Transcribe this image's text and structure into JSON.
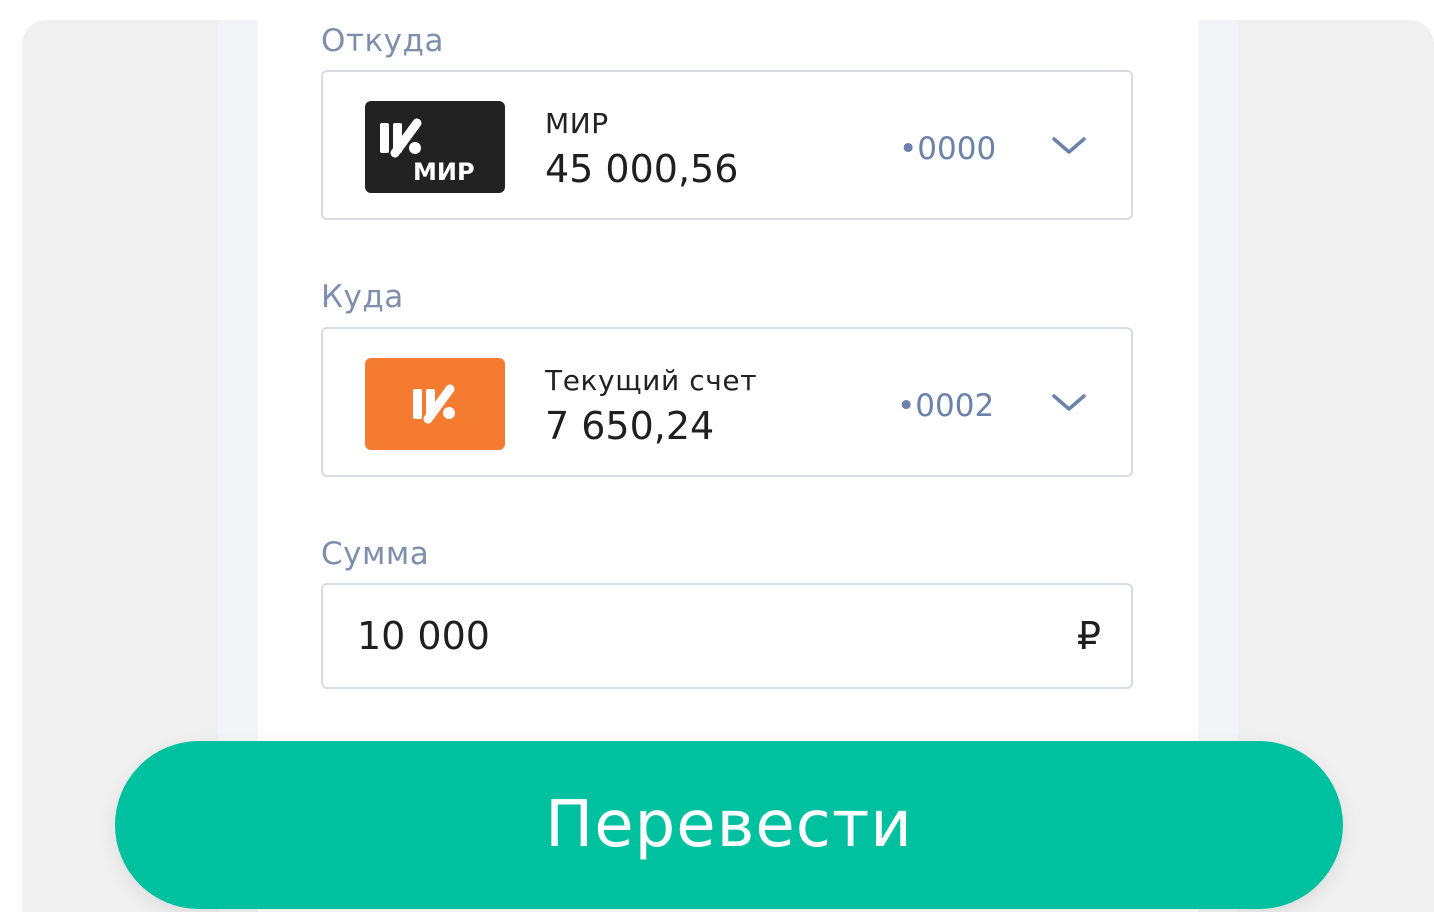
{
  "colors": {
    "label": "#7e8fae",
    "account_number": "#6b82ab",
    "border": "#d7dbe3",
    "mir_card": "#222222",
    "current_account_card": "#f47b30",
    "submit_button": "#00c19f"
  },
  "from": {
    "label": "Откуда",
    "card_icon": "mir-card-icon",
    "card_logo_text": "МИР",
    "name": "МИР",
    "balance": "45 000,56",
    "number": "•0000",
    "dropdown_icon": "chevron-down-icon"
  },
  "to": {
    "label": "Куда",
    "card_icon": "bank-logo-icon",
    "name": "Текущий счет",
    "balance": "7 650,24",
    "number": "•0002",
    "dropdown_icon": "chevron-down-icon"
  },
  "amount": {
    "label": "Сумма",
    "value": "10 000",
    "currency": "₽"
  },
  "submit": {
    "label": "Перевести"
  }
}
